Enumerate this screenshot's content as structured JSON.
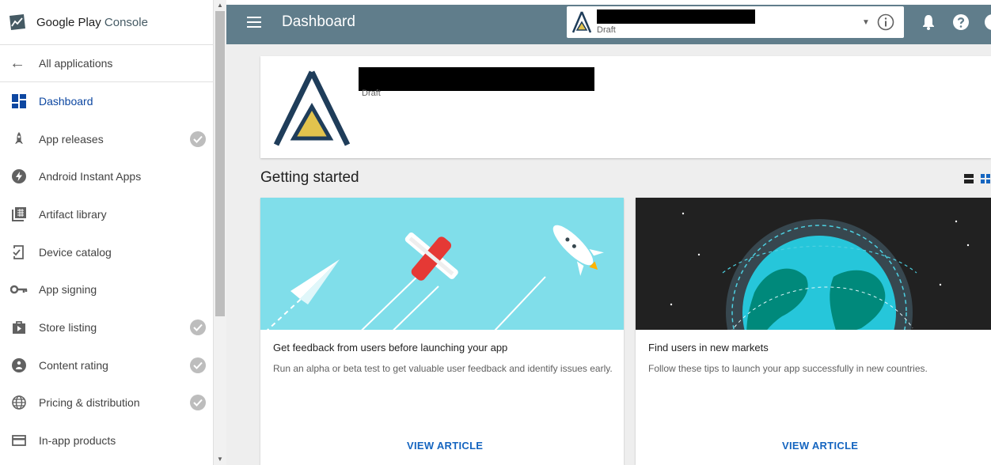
{
  "brand": {
    "name_part1": "Google Play",
    "name_part2": "Console"
  },
  "nav": {
    "back_label": "All applications",
    "items": [
      {
        "label": "Dashboard",
        "icon": "dashboard-icon",
        "active": true,
        "complete": false
      },
      {
        "label": "App releases",
        "icon": "rocket-icon",
        "active": false,
        "complete": true
      },
      {
        "label": "Android Instant Apps",
        "icon": "bolt-icon",
        "active": false,
        "complete": false
      },
      {
        "label": "Artifact library",
        "icon": "library-icon",
        "active": false,
        "complete": false
      },
      {
        "label": "Device catalog",
        "icon": "device-icon",
        "active": false,
        "complete": false
      },
      {
        "label": "App signing",
        "icon": "key-icon",
        "active": false,
        "complete": false
      },
      {
        "label": "Store listing",
        "icon": "store-icon",
        "active": false,
        "complete": true
      },
      {
        "label": "Content rating",
        "icon": "rating-icon",
        "active": false,
        "complete": true
      },
      {
        "label": "Pricing & distribution",
        "icon": "globe-icon",
        "active": false,
        "complete": true
      },
      {
        "label": "In-app products",
        "icon": "card-icon",
        "active": false,
        "complete": false
      }
    ]
  },
  "header": {
    "title": "Dashboard",
    "app_status": "Draft"
  },
  "app_card": {
    "status": "Draft"
  },
  "getting_started": {
    "title": "Getting started",
    "cards": [
      {
        "title": "Get feedback from users before launching your app",
        "description": "Run an alpha or beta test to get valuable user feedback and identify issues early.",
        "link": "VIEW ARTICLE"
      },
      {
        "title": "Find users in new markets",
        "description": "Follow these tips to launch your app successfully in new countries.",
        "link": "VIEW ARTICLE"
      }
    ]
  },
  "colors": {
    "topbar": "#607d8b",
    "accent": "#1565c0",
    "active_nav": "#0d47a1",
    "logo_navy": "#1f3d5a",
    "logo_yellow": "#e2c34d"
  }
}
